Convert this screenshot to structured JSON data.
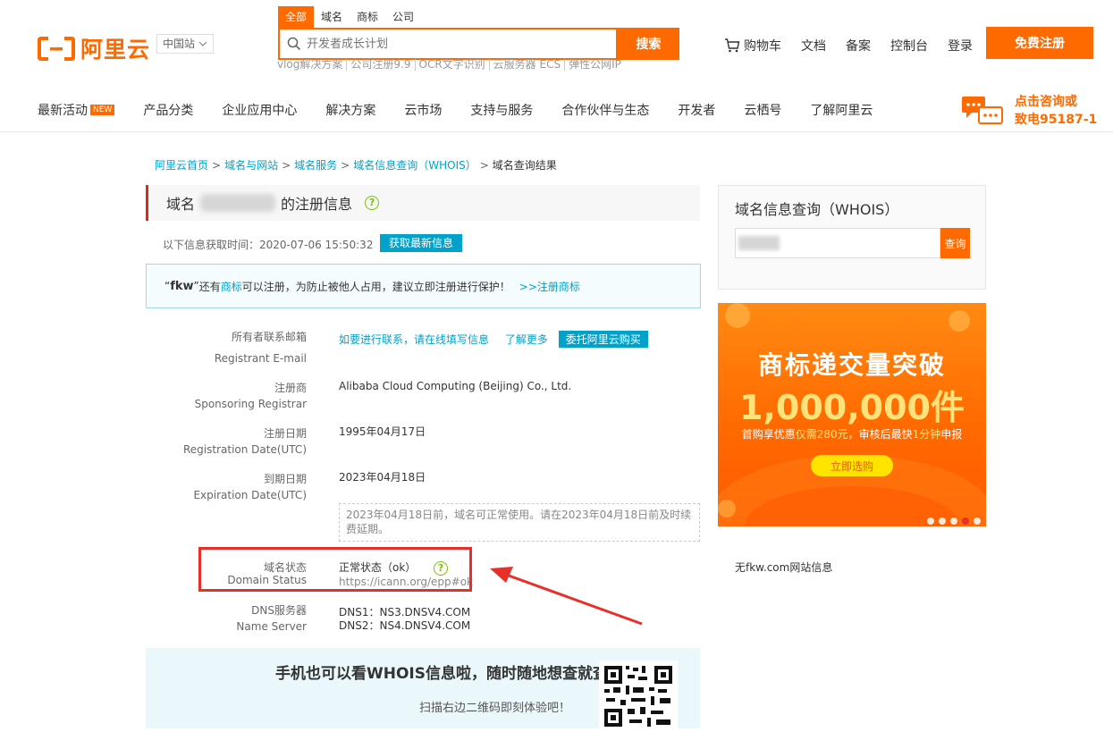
{
  "header": {
    "logo_text": "阿里云",
    "region": "中国站",
    "search_tabs": [
      "全部",
      "域名",
      "商标",
      "公司"
    ],
    "search_placeholder": "开发者成长计划",
    "search_button": "搜索",
    "hotwords": [
      "vlog解决方案",
      "公司注册9.9",
      "OCR文字识别",
      "云服务器 ECS",
      "弹性公网IP"
    ],
    "links": {
      "cart": "购物车",
      "docs": "文档",
      "beian": "备案",
      "console": "控制台",
      "login": "登录"
    },
    "register_button": "免费注册"
  },
  "nav": {
    "items": [
      "最新活动",
      "产品分类",
      "企业应用中心",
      "解决方案",
      "云市场",
      "支持与服务",
      "合作伙伴与生态",
      "开发者",
      "云栖号",
      "了解阿里云"
    ],
    "new_badge": "NEW",
    "consult_line1": "点击咨询或",
    "consult_line2": "致电95187-1"
  },
  "breadcrumb": {
    "items": [
      "阿里云首页",
      "域名与网站",
      "域名服务",
      "域名信息查询（WHOIS）"
    ],
    "current": "域名查询结果",
    "sep": ">"
  },
  "main": {
    "title_prefix": "域名",
    "title_suffix": "的注册信息",
    "help_glyph": "?",
    "fetch_time": "以下信息获取时间：2020-07-06 15:50:32",
    "refresh_button": "获取最新信息",
    "notice": {
      "name": "fkw",
      "text1": "还有",
      "link1": "商标",
      "text2": "可以注册，为防止被他人占用，建议立即注册进行保护！",
      "link2": ">>注册商标"
    },
    "rows": {
      "email": {
        "label_cn": "所有者联系邮箱",
        "label_en": "Registrant E-mail",
        "link1": "如要进行联系，请在线填写信息",
        "link2": "了解更多",
        "button": "委托阿里云购买"
      },
      "registrar": {
        "label_cn": "注册商",
        "label_en": "Sponsoring Registrar",
        "value": "Alibaba Cloud Computing (Beijing) Co., Ltd."
      },
      "reg_date": {
        "label_cn": "注册日期",
        "label_en": "Registration Date(UTC)",
        "value": "1995年04月17日"
      },
      "exp_date": {
        "label_cn": "到期日期",
        "label_en": "Expiration Date(UTC)",
        "value": "2023年04月18日"
      },
      "expire_note": "2023年04月18日前，域名可正常使用。请在2023年04月18日前及时续费延期。",
      "status": {
        "label_cn": "域名状态",
        "label_en": "Domain Status",
        "value": "正常状态（ok）",
        "link": "https://icann.org/epp#ok"
      },
      "dns": {
        "label_cn": "DNS服务器",
        "label_en": "Name Server",
        "dns1": "DNS1：NS3.DNSV4.COM",
        "dns2": "DNS2：NS4.DNSV4.COM"
      }
    },
    "promo": {
      "title": "手机也可以看WHOIS信息啦，随时随地想查就查",
      "sub": "扫描右边二维码即刻体验吧！"
    }
  },
  "sidebar": {
    "whois_title": "域名信息查询（WHOIS）",
    "query_button": "查询",
    "banner": {
      "title": "商标递交量突破",
      "number": "1,000,000件",
      "sub_prefix": "首购享优惠",
      "sub_highlight1": "仅需280元",
      "sub_mid": "，审核后最快",
      "sub_highlight2": "1分钟",
      "sub_suffix": "申报",
      "button": "立即选购",
      "slides_count": 5,
      "active_slide": 4
    },
    "site_info": "无fkw.com网站信息"
  },
  "colors": {
    "brand": "#ff6a00",
    "link": "#00a2ca",
    "alert_red": "#e8302b",
    "help_green": "#7cc000"
  }
}
